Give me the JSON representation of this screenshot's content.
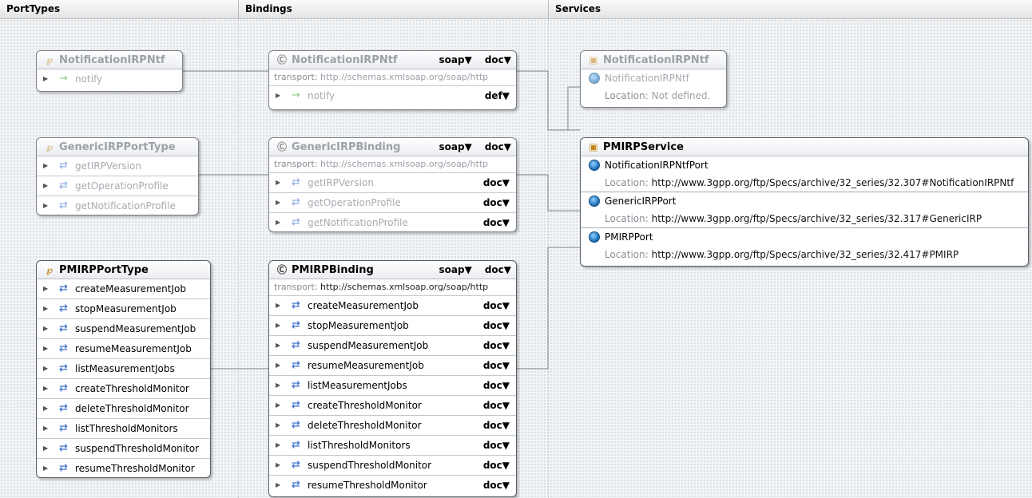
{
  "header": {
    "porttypes": "PortTypes",
    "bindings": "Bindings",
    "services": "Services"
  },
  "porttypes": [
    {
      "name": "NotificationIRPNtf",
      "ops": [
        "notify"
      ]
    },
    {
      "name": "GenericIRPPortType",
      "ops": [
        "getIRPVersion",
        "getOperationProfile",
        "getNotificationProfile"
      ]
    },
    {
      "name": "PMIRPPortType",
      "ops": [
        "createMeasurementJob",
        "stopMeasurementJob",
        "suspendMeasurementJob",
        "resumeMeasurementJob",
        "listMeasurementJobs",
        "createThresholdMonitor",
        "deleteThresholdMonitor",
        "listThresholdMonitors",
        "suspendThresholdMonitor",
        "resumeThresholdMonitor"
      ]
    }
  ],
  "bindings": [
    {
      "name": "NotificationIRPNtf",
      "protocol": "soap",
      "style": "doc",
      "transport_label": "transport:",
      "transport": "http://schemas.xmlsoap.org/soap/http",
      "ops": [
        {
          "name": "notify",
          "style": "def"
        }
      ]
    },
    {
      "name": "GenericIRPBinding",
      "protocol": "soap",
      "style": "doc",
      "transport_label": "transport:",
      "transport": "http://schemas.xmlsoap.org/soap/http",
      "ops": [
        {
          "name": "getIRPVersion",
          "style": "doc"
        },
        {
          "name": "getOperationProfile",
          "style": "doc"
        },
        {
          "name": "getNotificationProfile",
          "style": "doc"
        }
      ]
    },
    {
      "name": "PMIRPBinding",
      "protocol": "soap",
      "style": "doc",
      "transport_label": "transport:",
      "transport": "http://schemas.xmlsoap.org/soap/http",
      "ops": [
        {
          "name": "createMeasurementJob",
          "style": "doc"
        },
        {
          "name": "stopMeasurementJob",
          "style": "doc"
        },
        {
          "name": "suspendMeasurementJob",
          "style": "doc"
        },
        {
          "name": "resumeMeasurementJob",
          "style": "doc"
        },
        {
          "name": "listMeasurementJobs",
          "style": "doc"
        },
        {
          "name": "createThresholdMonitor",
          "style": "doc"
        },
        {
          "name": "deleteThresholdMonitor",
          "style": "doc"
        },
        {
          "name": "listThresholdMonitors",
          "style": "doc"
        },
        {
          "name": "suspendThresholdMonitor",
          "style": "doc"
        },
        {
          "name": "resumeThresholdMonitor",
          "style": "doc"
        }
      ]
    }
  ],
  "services": [
    {
      "name": "NotificationIRPNtf",
      "ports": [
        {
          "name": "NotificationIRPNtf",
          "location_label": "Location:",
          "location": "Not defined."
        }
      ]
    },
    {
      "name": "PMIRPService",
      "ports": [
        {
          "name": "NotificationIRPNtfPort",
          "location_label": "Location:",
          "location": "http://www.3gpp.org/ftp/Specs/archive/32_series/32.307#NotificationIRPNtf"
        },
        {
          "name": "GenericIRPPort",
          "location_label": "Location:",
          "location": "http://www.3gpp.org/ftp/Specs/archive/32_series/32.317#GenericIRP"
        },
        {
          "name": "PMIRPPort",
          "location_label": "Location:",
          "location": "http://www.3gpp.org/ftp/Specs/archive/32_series/32.417#PMIRP"
        }
      ]
    }
  ]
}
